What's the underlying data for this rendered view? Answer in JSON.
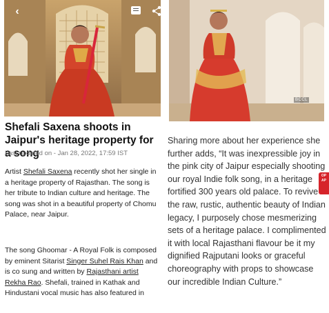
{
  "left_panel": {
    "nav": {
      "back_icon": "chevron-left-icon",
      "comment_icon": "comment-icon",
      "share_icon": "share-icon"
    },
    "article": {
      "title": "Shefali Saxena shoots in Jaipur's heritage property for a song",
      "updated": "Last updated on - Jan 28, 2022, 17:59 IST",
      "para1": [
        {
          "text": "Artist "
        },
        {
          "link": "Shefali Saxena"
        },
        {
          "text": " recently shot her single in a heritage property of Rajasthan. The song is her tribute to Indian culture and heritage. The song was shot in a beautiful property of Chomu Palace, near Jaipur."
        }
      ],
      "para2": [
        {
          "text": "The song Ghoomar - A Royal Folk is composed by eminent Sitarist "
        },
        {
          "link": "Singer Suhel Rais Khan"
        },
        {
          "text": " and is co sung and written by "
        },
        {
          "link": "Rajasthani artist Rekha Rao"
        },
        {
          "text": ". Shefali, trained in Kathak and Hindustani vocal music has also featured in"
        }
      ]
    }
  },
  "right_panel": {
    "quote": "Sharing more about her experience she further adds, “It was inexpressible joy in the pink city of Jaipur especially shooting our royal Indie folk song, in a heritage fortified 300 years old palace. To revive the raw, rustic, authentic beauty of Indian legacy, I purposely chose mesmerizing sets of a heritage palace. I complimented it with local Rajasthani flavour be it my dignified Rajputani looks or graceful choreography with props to showcase our incredible Indian Culture.”",
    "watermark": "BCCL",
    "side_tab_label": "OP AP"
  },
  "colors": {
    "accent_red": "#d6232a",
    "text": "#222222",
    "muted": "#777777"
  }
}
